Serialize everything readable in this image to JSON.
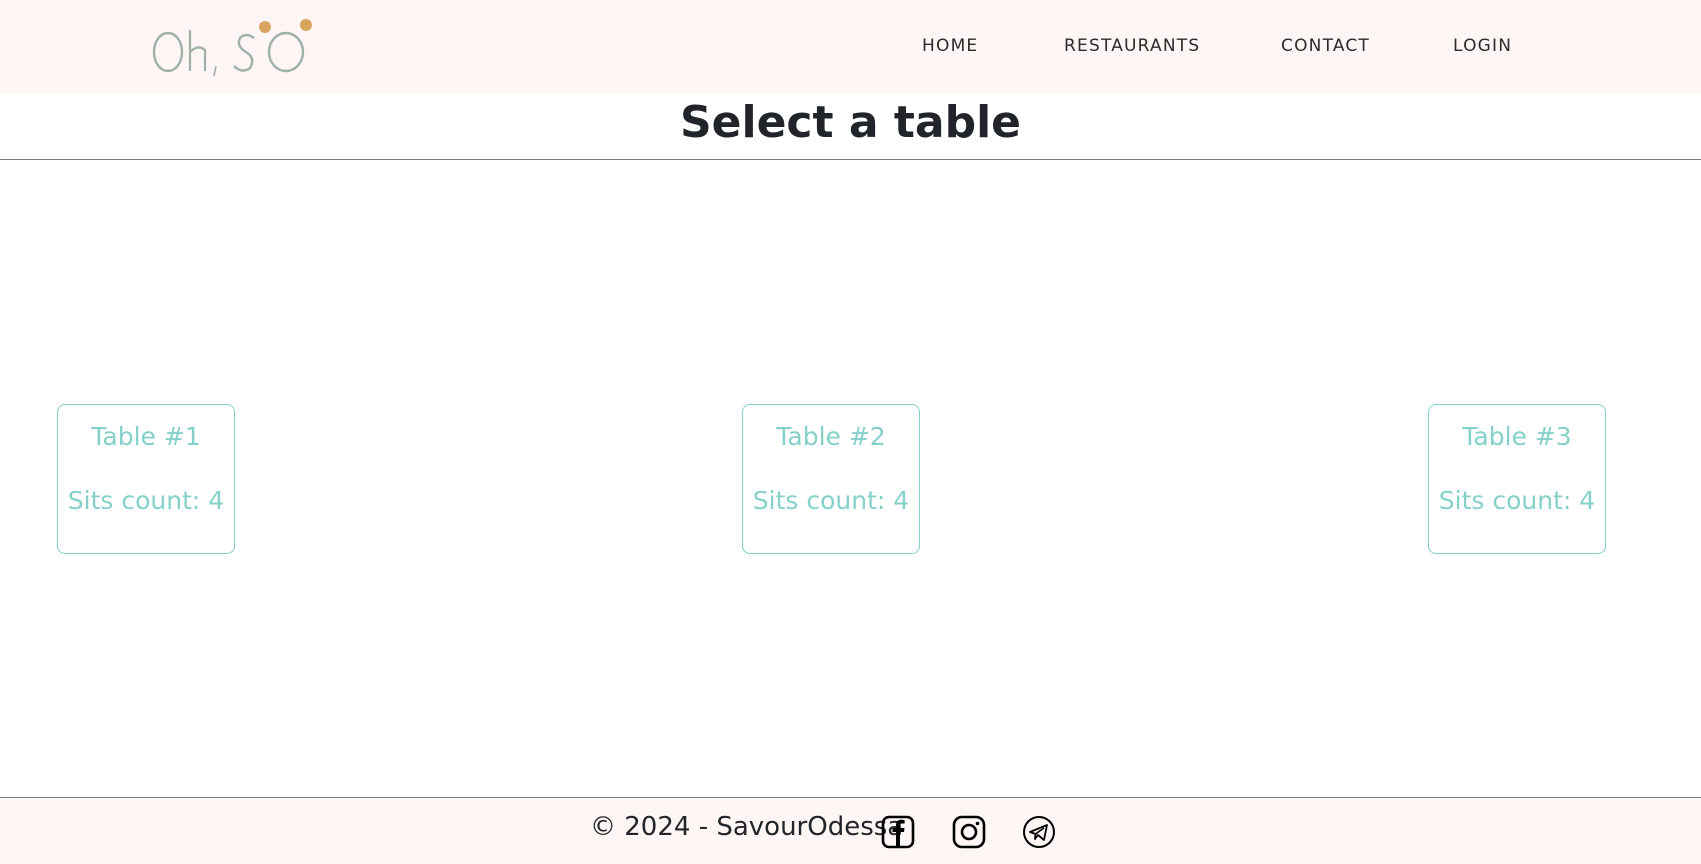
{
  "header": {
    "logo_text": "Oh, SO",
    "nav": {
      "home": "HOME",
      "restaurants": "RESTAURANTS",
      "contact": "CONTACT",
      "login": "LOGIN"
    }
  },
  "main": {
    "title": "Select a table",
    "tables": [
      {
        "name": "Table #1",
        "sits": "Sits count: 4"
      },
      {
        "name": "Table #2",
        "sits": "Sits count: 4"
      },
      {
        "name": "Table #3",
        "sits": "Sits count: 4"
      }
    ]
  },
  "footer": {
    "copyright": "© 2024 - SavourOdessa",
    "social": [
      "facebook-icon",
      "instagram-icon",
      "telegram-icon"
    ]
  },
  "colors": {
    "header_bg": "#fdf6f5",
    "accent": "#86d0ca",
    "logo_gold": "#d9a460",
    "logo_grey": "#9fb0aa"
  }
}
